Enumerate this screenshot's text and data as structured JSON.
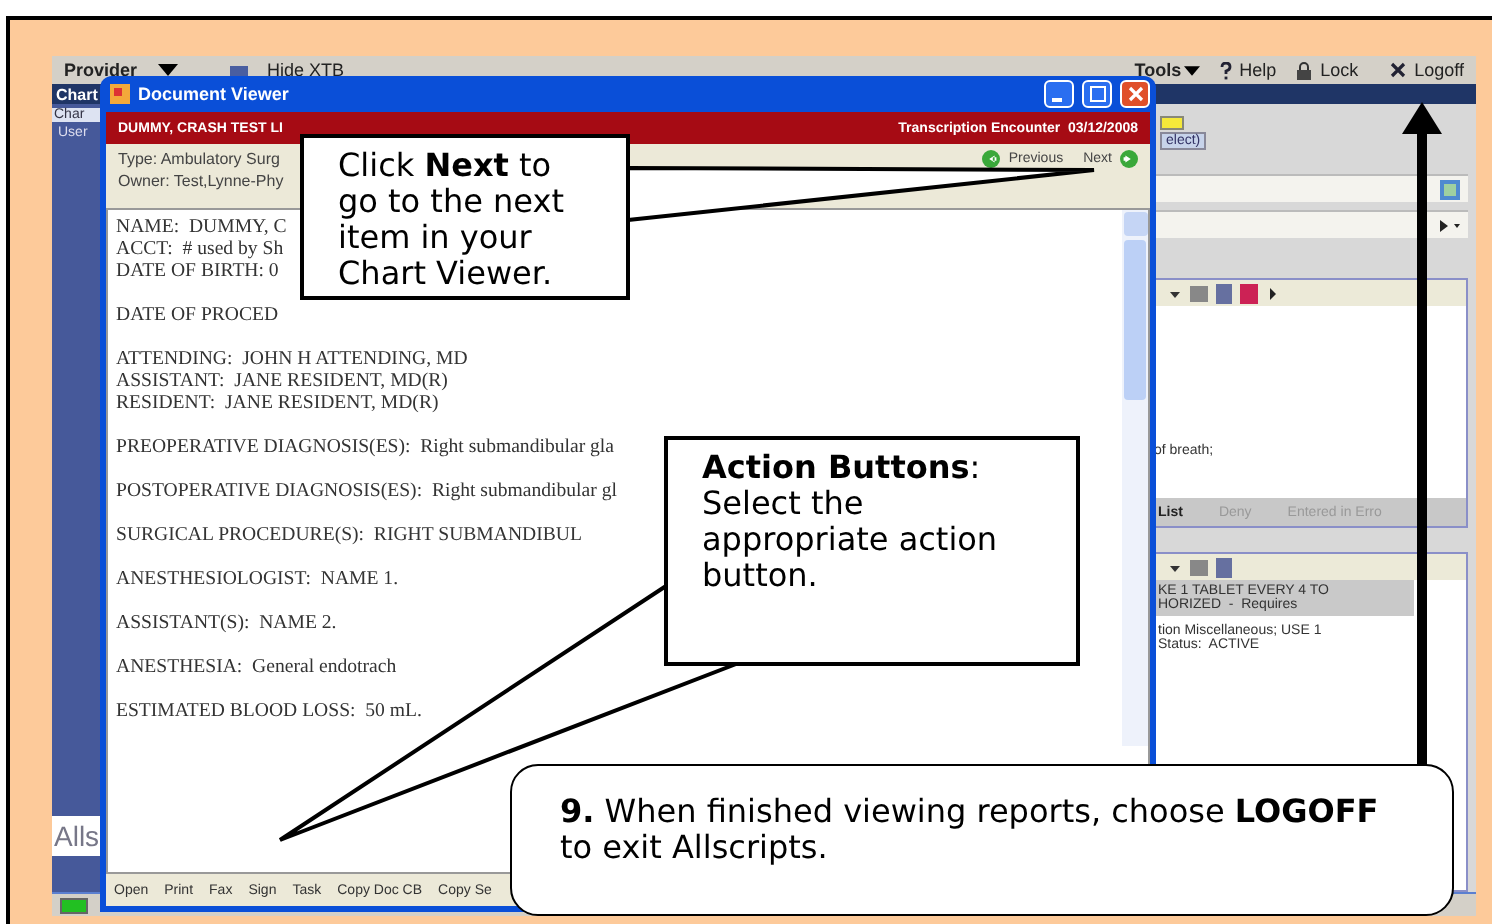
{
  "app": {
    "menu": {
      "provider": "Provider",
      "hide": "Hide XTB",
      "tools": "Tools",
      "help": "Help",
      "lock": "Lock",
      "logoff": "Logoff"
    },
    "nav_title": "Chart",
    "sidebar": {
      "tab": "Char",
      "item": "User",
      "footer": "Alls"
    },
    "right_pane": {
      "badge_link": "elect)",
      "panel_1": {
        "lines": [
          "of breath;"
        ],
        "actions": [
          "List",
          "Deny",
          "Entered in Erro"
        ]
      },
      "panel_2": {
        "highlight_lines": [
          "KE 1 TABLET EVERY 4 TO",
          "HORIZED  -  Requires"
        ],
        "lines": [
          "tion Miscellaneous; USE 1",
          "Status:  ACTIVE"
        ]
      }
    }
  },
  "document_viewer": {
    "title": "Document Viewer",
    "banner_left": "DUMMY, CRASH TEST LI",
    "banner_right": "Transcription Encounter  03/12/2008",
    "type": "Type: Ambulatory Surg",
    "owner": "Owner: Test,Lynne-Phy",
    "previous": "Previous",
    "next": "Next",
    "paragraphs": [
      [
        "NAME:  DUMMY, C",
        "ACCT:  # used by Sh",
        "DATE OF BIRTH: 0"
      ],
      [
        "DATE OF PROCED"
      ],
      [
        "ATTENDING:  JOHN H ATTENDING, MD",
        "ASSISTANT:  JANE RESIDENT, MD(R)",
        "RESIDENT:  JANE RESIDENT, MD(R)"
      ],
      [
        "PREOPERATIVE DIAGNOSIS(ES):  Right submandibular gla"
      ],
      [
        "POSTOPERATIVE DIAGNOSIS(ES):  Right submandibular gl"
      ],
      [
        "SURGICAL PROCEDURE(S):  RIGHT SUBMANDIBUL"
      ],
      [
        "ANESTHESIOLOGIST:  NAME 1."
      ],
      [
        "ASSISTANT(S):  NAME 2."
      ],
      [
        "ANESTHESIA:  General endotrach"
      ],
      [
        "ESTIMATED BLOOD LOSS:  50 mL."
      ]
    ],
    "actions": [
      "Open",
      "Print",
      "Fax",
      "Sign",
      "Task",
      "Copy Doc CB",
      "Copy Se"
    ]
  },
  "callouts": [
    {
      "kind": "box",
      "text": "Click **Next** to go to the next item in your Chart Viewer."
    },
    {
      "kind": "box",
      "text": "**Action Buttons**: Select the appropriate action button."
    },
    {
      "kind": "rounded",
      "text": "**9.** When finished viewing reports, choose **LOGOFF** to exit Allscripts."
    }
  ]
}
